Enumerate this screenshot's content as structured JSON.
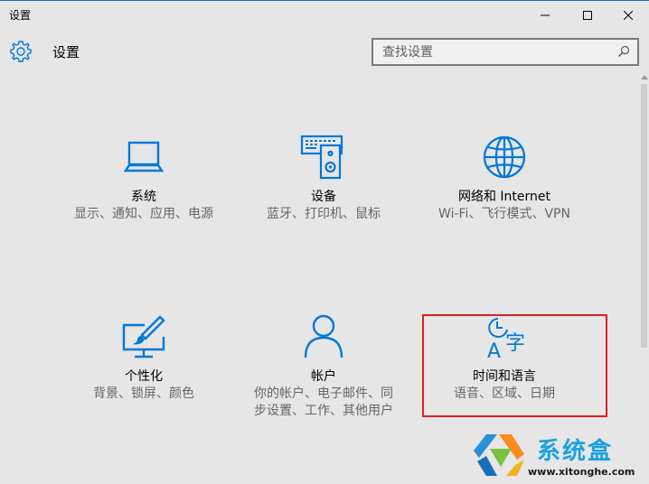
{
  "window": {
    "title": "设置",
    "controls": [
      "minimize-icon",
      "maximize-icon",
      "close-icon"
    ]
  },
  "header": {
    "title": "设置",
    "icon": "gear-icon"
  },
  "search": {
    "placeholder": "查找设置",
    "icon": "search-icon"
  },
  "tiles": [
    {
      "name": "系统",
      "desc": "显示、通知、应用、电源",
      "icon": "laptop-icon"
    },
    {
      "name": "设备",
      "desc": "蓝牙、打印机、鼠标",
      "icon": "keyboard-speaker-icon"
    },
    {
      "name": "网络和 Internet",
      "desc": "Wi-Fi、飞行模式、VPN",
      "icon": "globe-icon"
    },
    {
      "name": "个性化",
      "desc": "背景、锁屏、颜色",
      "icon": "personalize-icon"
    },
    {
      "name": "帐户",
      "desc": "你的帐户、电子邮件、同步设置、工作、其他用户",
      "icon": "user-icon"
    },
    {
      "name": "时间和语言",
      "desc": "语音、区域、日期",
      "icon": "time-language-icon"
    }
  ],
  "watermark": {
    "brand": "系统盒",
    "url": "www.xitonghe.com"
  },
  "colors": {
    "accent": "#0078d7",
    "background": "#e6e6e6",
    "highlight": "#e02020"
  }
}
